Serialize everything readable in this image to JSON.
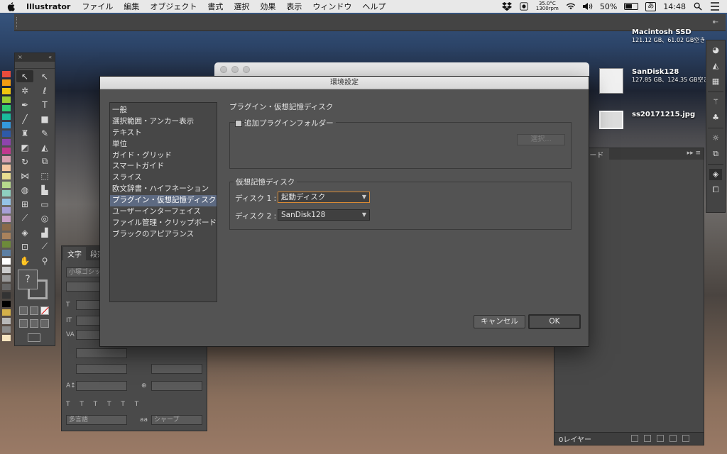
{
  "menubar": {
    "app_name": "Illustrator",
    "items": [
      "ファイル",
      "編集",
      "オブジェクト",
      "書式",
      "選択",
      "効果",
      "表示",
      "ウィンドウ",
      "ヘルプ"
    ],
    "temp": "35.0°C",
    "rpm": "1300rpm",
    "battery": "50%",
    "ime": "あ",
    "clock": "14:48"
  },
  "desktop": {
    "icons": [
      {
        "name": "Macintosh SSD",
        "sub": "121.12 GB、61.02 GB空き"
      },
      {
        "name": "SanDisk128",
        "sub": "127.85 GB、124.35 GB空き"
      },
      {
        "name": "ss20171215.jpg",
        "sub": ""
      }
    ]
  },
  "char_panel": {
    "tabs": [
      "文字",
      "段落"
    ],
    "font": "小塚ゴシッ",
    "language": "多言語",
    "aa": "シャープ",
    "aa_icon_label": "aa"
  },
  "artboard_panel": {
    "tab": "アートボード",
    "footer": "0レイヤー"
  },
  "dialog": {
    "title": "環境設定",
    "categories": [
      "一般",
      "選択範囲・アンカー表示",
      "テキスト",
      "単位",
      "ガイド・グリッド",
      "スマートガイド",
      "スライス",
      "欧文辞書・ハイフネーション",
      "プラグイン・仮想記憶ディスク",
      "ユーザーインターフェイス",
      "ファイル管理・クリップボード",
      "ブラックのアピアランス"
    ],
    "selected_index": 8,
    "section_title": "プラグイン・仮想記憶ディスク",
    "plugins_checkbox_label": "追加プラグインフォルダー",
    "choose_button": "選択...",
    "scratch_title": "仮想記憶ディスク",
    "disk1_label": "ディスク 1 :",
    "disk1_value": "起動ディスク",
    "disk2_label": "ディスク 2 :",
    "disk2_value": "SanDisk128",
    "cancel": "キャンセル",
    "ok": "OK"
  },
  "colors": {
    "dialog_bg": "#535353",
    "selection": "#5d6a82",
    "focus_ring": "#d98a34"
  }
}
